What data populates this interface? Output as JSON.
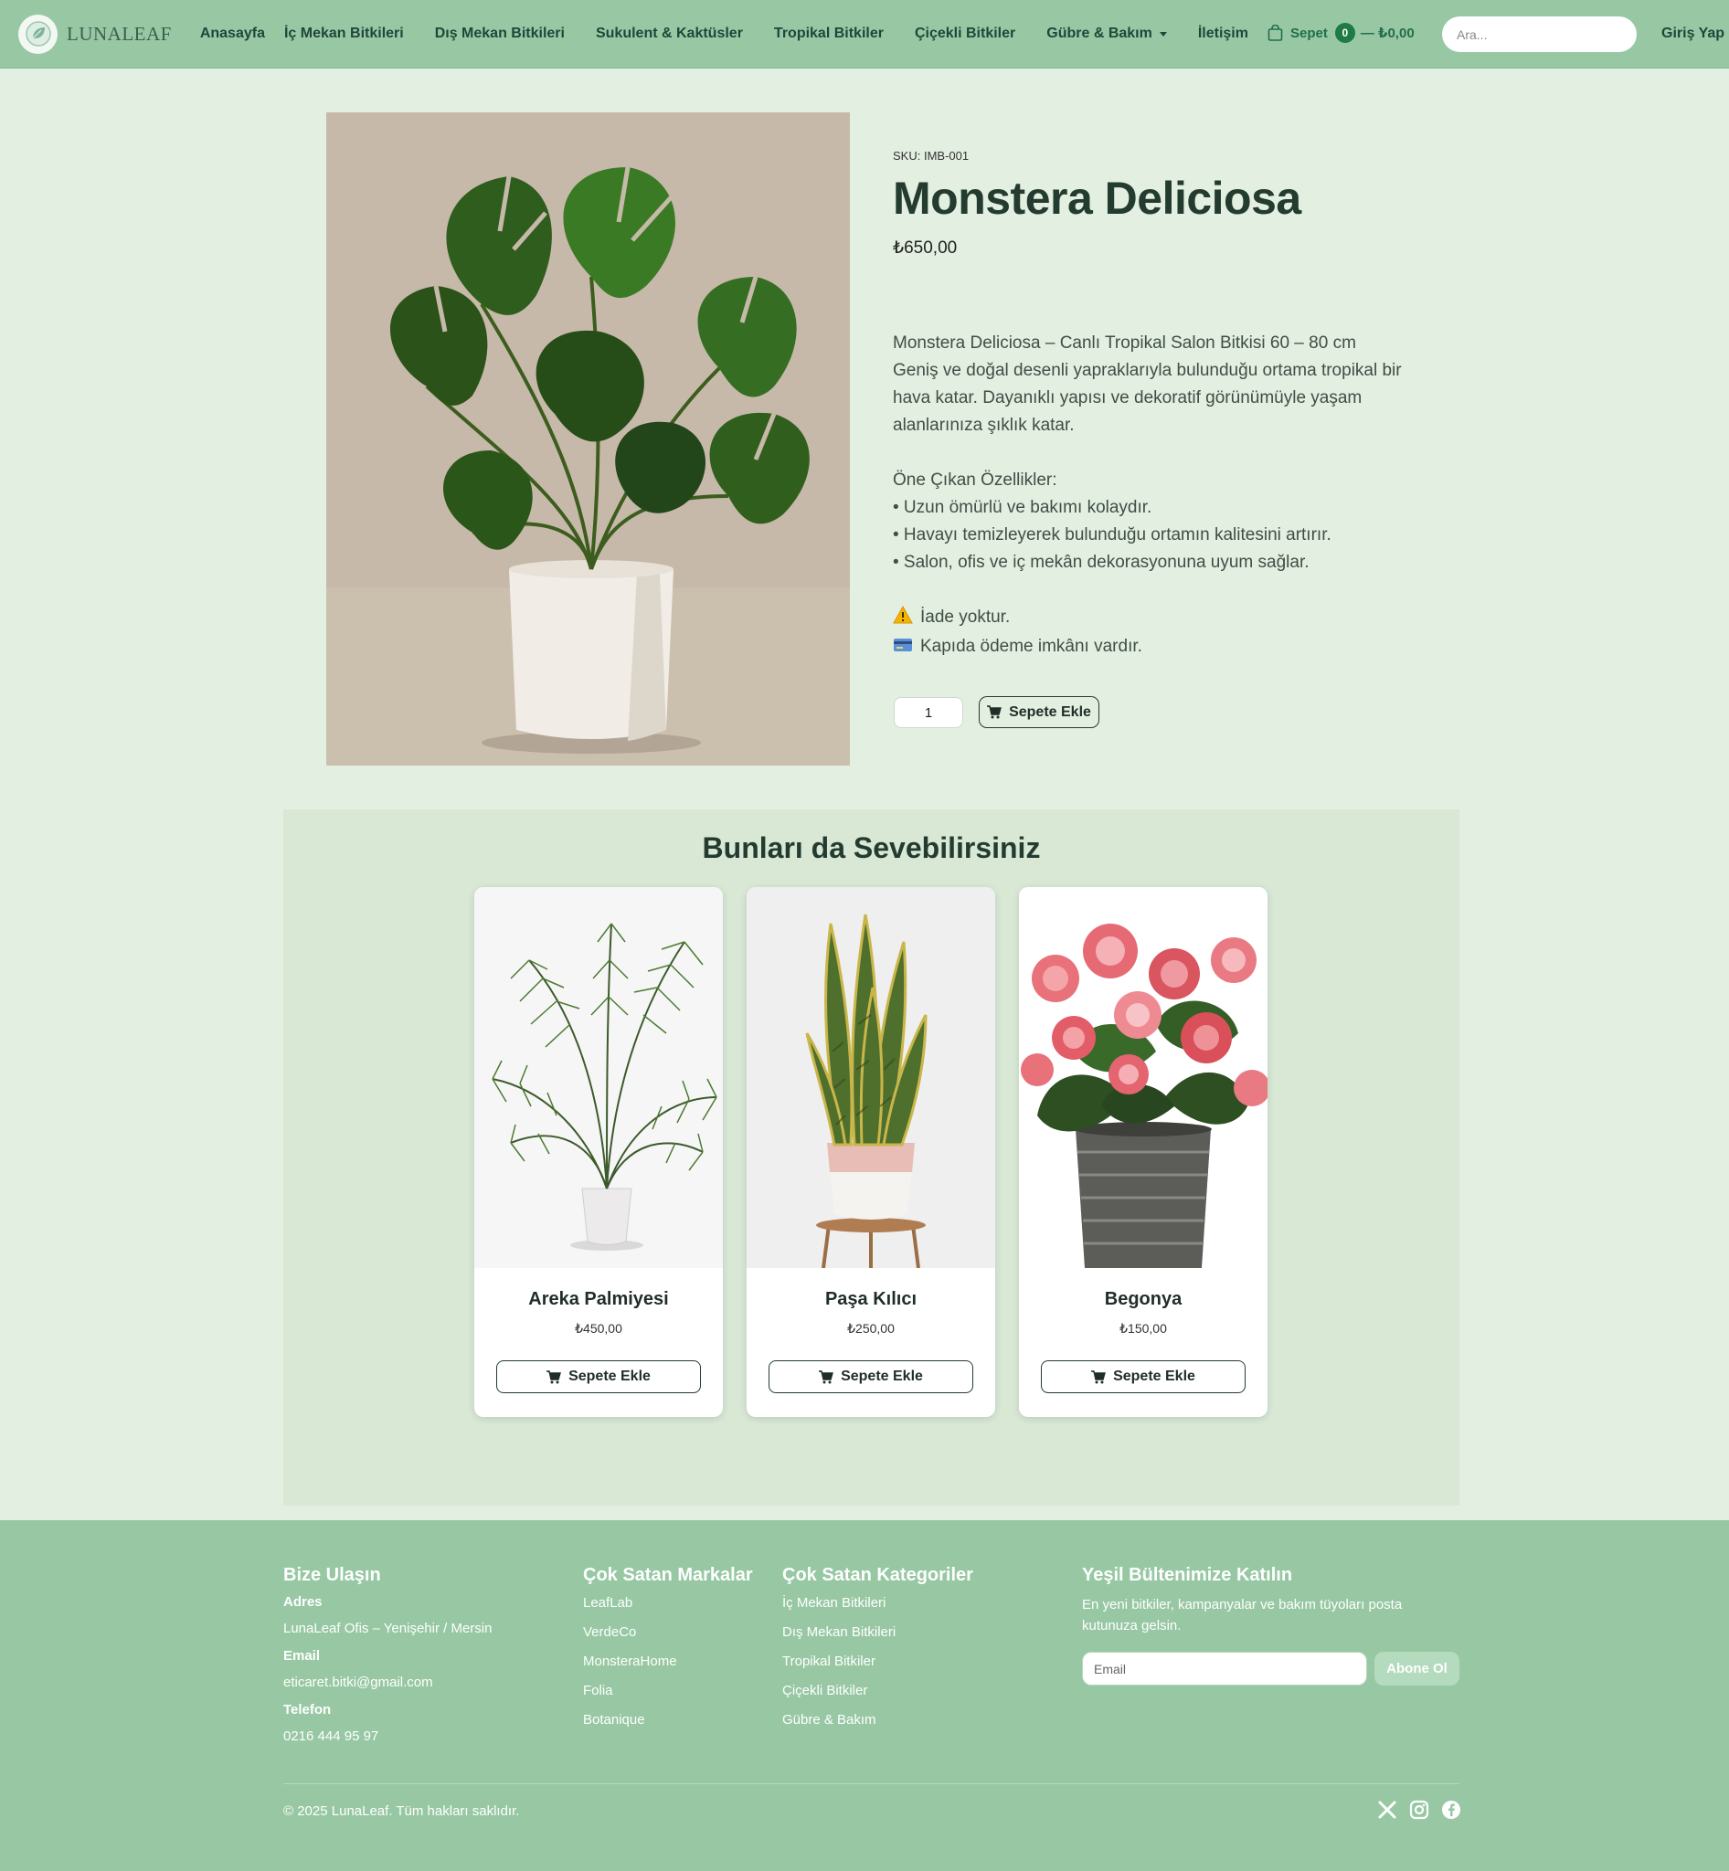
{
  "nav": {
    "brand": "LUNALEAF",
    "links": [
      "Anasayfa",
      "İç Mekan Bitkileri",
      "Dış Mekan Bitkileri",
      "Sukulent & Kaktüsler",
      "Tropikal Bitkiler",
      "Çiçekli Bitkiler",
      "Gübre & Bakım",
      "İletişim"
    ],
    "cart_label": "Sepet",
    "cart_count": "0",
    "cart_total": "— ₺0,00",
    "search_placeholder": "Ara...",
    "login": "Giriş Yap"
  },
  "product": {
    "sku": "SKU: IMB-001",
    "title": "Monstera Deliciosa",
    "price": "₺650,00",
    "desc_lines": [
      "Monstera Deliciosa – Canlı Tropikal Salon Bitkisi 60 – 80 cm",
      "Geniş ve doğal desenli yapraklarıyla bulunduğu ortama tropikal bir hava katar. Dayanıklı yapısı ve dekoratif görünümüyle yaşam alanlarınıza şıklık katar."
    ],
    "features_title": "Öne Çıkan Özellikler:",
    "features": [
      "• Uzun ömürlü ve bakımı kolaydır.",
      "• Havayı temizleyerek bulunduğu ortamın kalitesini artırır.",
      "• Salon, ofis ve iç mekân dekorasyonuna uyum sağlar."
    ],
    "notice_return": "İade yoktur.",
    "notice_payment": "Kapıda ödeme imkânı vardır.",
    "quantity": "1",
    "add_to_cart": "Sepete Ekle"
  },
  "related": {
    "title": "Bunları da Sevebilirsiniz",
    "items": [
      {
        "name": "Areka Palmiyesi",
        "price": "₺450,00",
        "button": "Sepete Ekle"
      },
      {
        "name": "Paşa Kılıcı",
        "price": "₺250,00",
        "button": "Sepete Ekle"
      },
      {
        "name": "Begonya",
        "price": "₺150,00",
        "button": "Sepete Ekle"
      }
    ]
  },
  "footer": {
    "contact": {
      "title": "Bize Ulaşın",
      "address_label": "Adres",
      "address": "LunaLeaf Ofis – Yenişehir / Mersin",
      "email_label": "Email",
      "email": "eticaret.bitki@gmail.com",
      "phone_label": "Telefon",
      "phone": "0216 444 95 97"
    },
    "brands": {
      "title": "Çok Satan Markalar",
      "items": [
        "LeafLab",
        "VerdeCo",
        "MonsteraHome",
        "Folia",
        "Botanique"
      ]
    },
    "categories": {
      "title": "Çok Satan Kategoriler",
      "items": [
        "İç Mekan Bitkileri",
        "Dış Mekan Bitkileri",
        "Tropikal Bitkiler",
        "Çiçekli Bitkiler",
        "Gübre & Bakım"
      ]
    },
    "newsletter": {
      "title": "Yeşil Bültenimize Katılın",
      "text": "En yeni bitkiler, kampanyalar ve bakım tüyoları posta kutunuza gelsin.",
      "email_placeholder": "Email",
      "button": "Abone Ol"
    },
    "copyright": "© 2025 LunaLeaf. Tüm hakları saklıdır.",
    "social_icons": [
      "x-icon",
      "instagram-icon",
      "facebook-icon"
    ]
  },
  "colors": {
    "navbar": "#97c8a3",
    "page_bg": "#e3efe0",
    "related_bg": "#d8e8d5",
    "footer": "#97c8a3",
    "accent": "#1e7a47"
  }
}
